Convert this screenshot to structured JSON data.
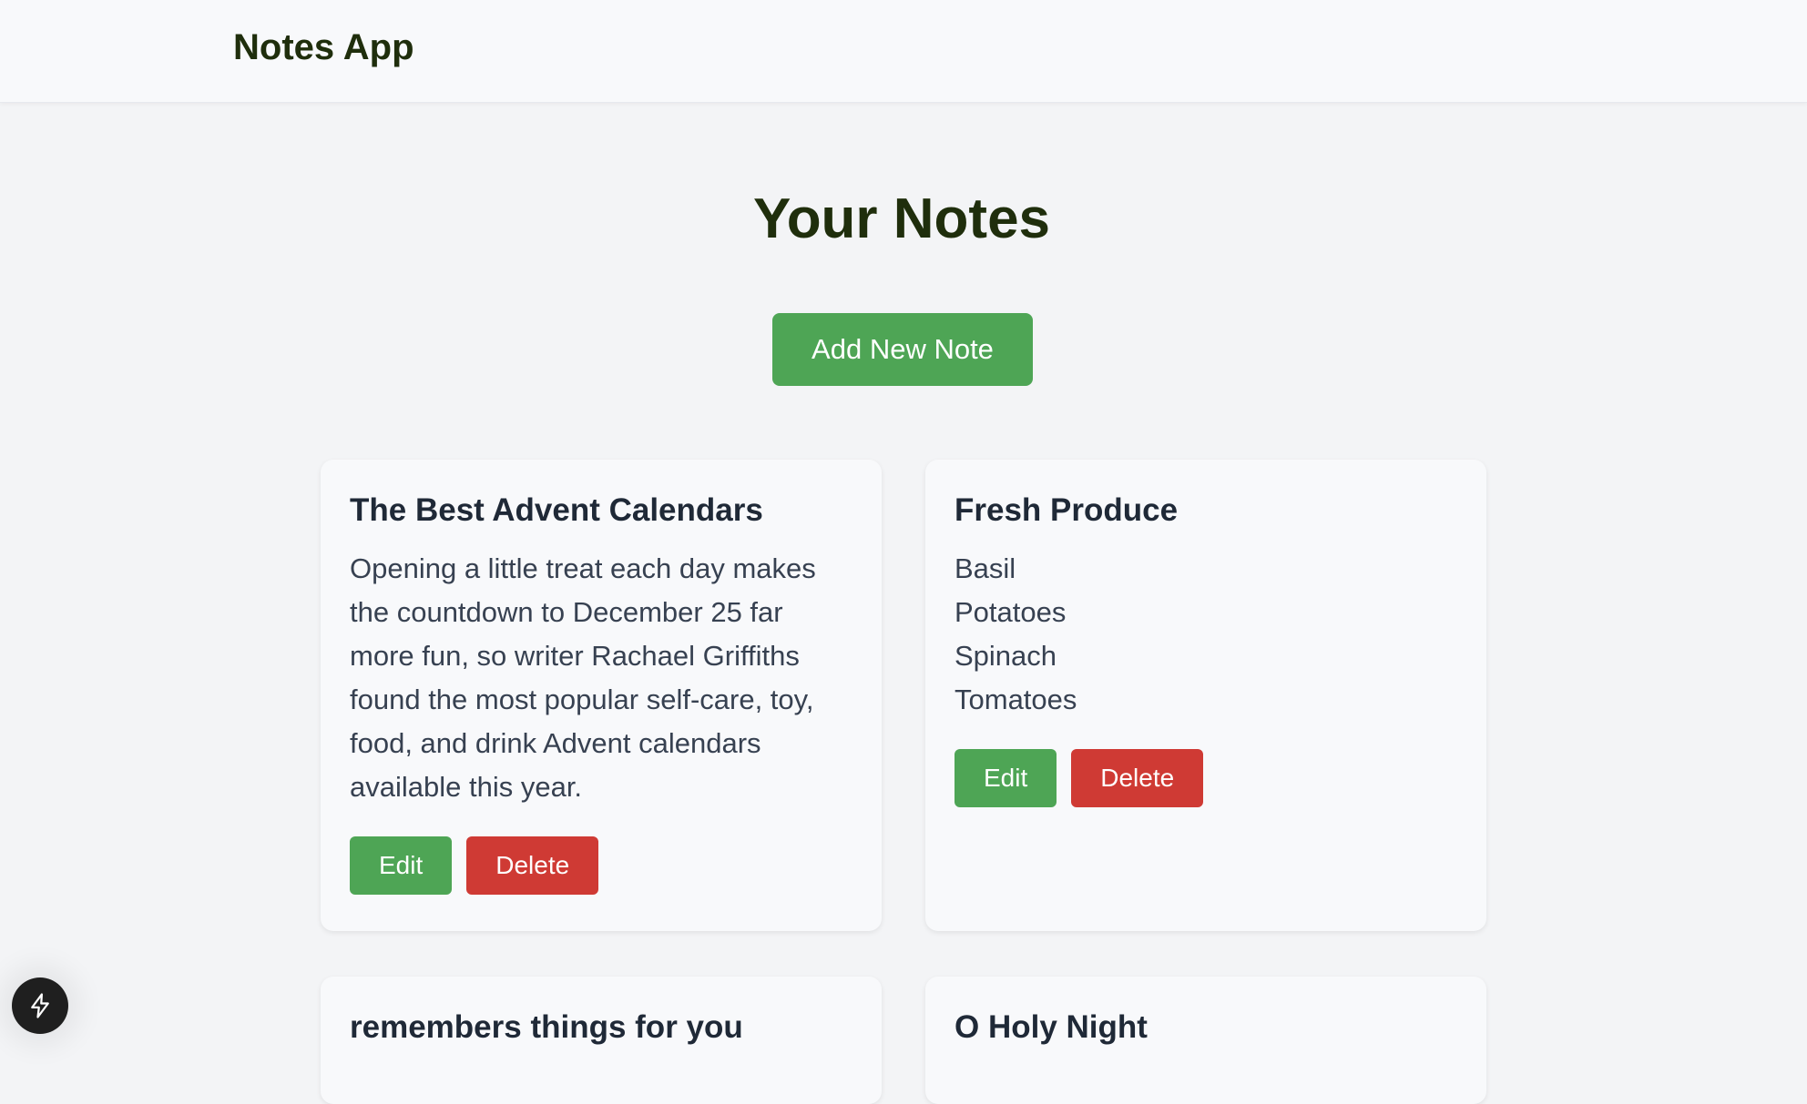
{
  "header": {
    "brand": "Notes App"
  },
  "main": {
    "title": "Your Notes",
    "add_button_label": "Add New Note"
  },
  "notes": [
    {
      "title": "The Best Advent Calendars",
      "body_lines": [
        "Opening a little treat each day makes",
        "the countdown to December 25 far",
        "more fun, so writer Rachael Griffiths",
        "found the most popular self-care, toy,",
        "food, and drink Advent calendars",
        "available this year."
      ],
      "edit_label": "Edit",
      "delete_label": "Delete"
    },
    {
      "title": "Fresh Produce",
      "body_lines": [
        "Basil",
        "Potatoes",
        "Spinach",
        "Tomatoes"
      ],
      "edit_label": "Edit",
      "delete_label": "Delete"
    },
    {
      "title": "remembers things for you"
    },
    {
      "title": "O Holy Night"
    }
  ],
  "floating_button": {
    "icon": "lightning-bolt-icon"
  },
  "colors": {
    "primary_green": "#4ea555",
    "danger_red": "#cf3a34",
    "heading_dark": "#1f2e0c",
    "page_bg": "#f3f4f6",
    "card_bg": "#f8f9fb"
  }
}
